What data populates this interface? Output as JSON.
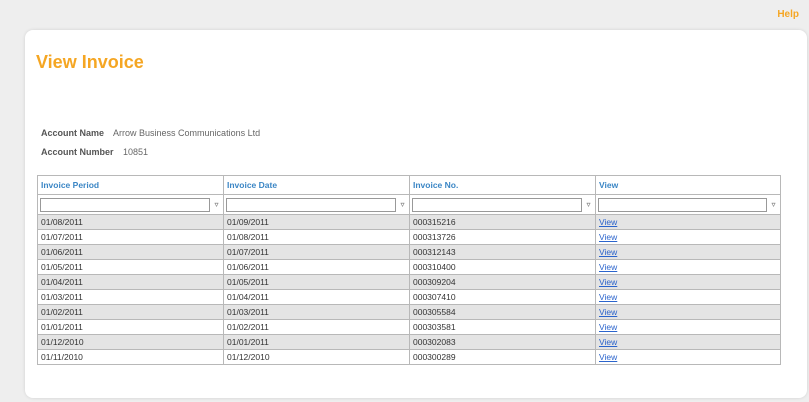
{
  "header": {
    "help_label": "Help"
  },
  "page": {
    "title": "View Invoice"
  },
  "account": {
    "name_label": "Account Name",
    "name_value": "Arrow Business Communications Ltd",
    "number_label": "Account Number",
    "number_value": "10851"
  },
  "table": {
    "columns": [
      "Invoice Period",
      "Invoice Date",
      "Invoice No.",
      "View"
    ],
    "filter_icon": "filter-icon",
    "rows": [
      {
        "period": "01/08/2011",
        "date": "01/09/2011",
        "number": "000315216",
        "view": "View"
      },
      {
        "period": "01/07/2011",
        "date": "01/08/2011",
        "number": "000313726",
        "view": "View"
      },
      {
        "period": "01/06/2011",
        "date": "01/07/2011",
        "number": "000312143",
        "view": "View"
      },
      {
        "period": "01/05/2011",
        "date": "01/06/2011",
        "number": "000310400",
        "view": "View"
      },
      {
        "period": "01/04/2011",
        "date": "01/05/2011",
        "number": "000309204",
        "view": "View"
      },
      {
        "period": "01/03/2011",
        "date": "01/04/2011",
        "number": "000307410",
        "view": "View"
      },
      {
        "period": "01/02/2011",
        "date": "01/03/2011",
        "number": "000305584",
        "view": "View"
      },
      {
        "period": "01/01/2011",
        "date": "01/02/2011",
        "number": "000303581",
        "view": "View"
      },
      {
        "period": "01/12/2010",
        "date": "01/01/2011",
        "number": "000302083",
        "view": "View"
      },
      {
        "period": "01/11/2010",
        "date": "01/12/2010",
        "number": "000300289",
        "view": "View"
      }
    ]
  }
}
